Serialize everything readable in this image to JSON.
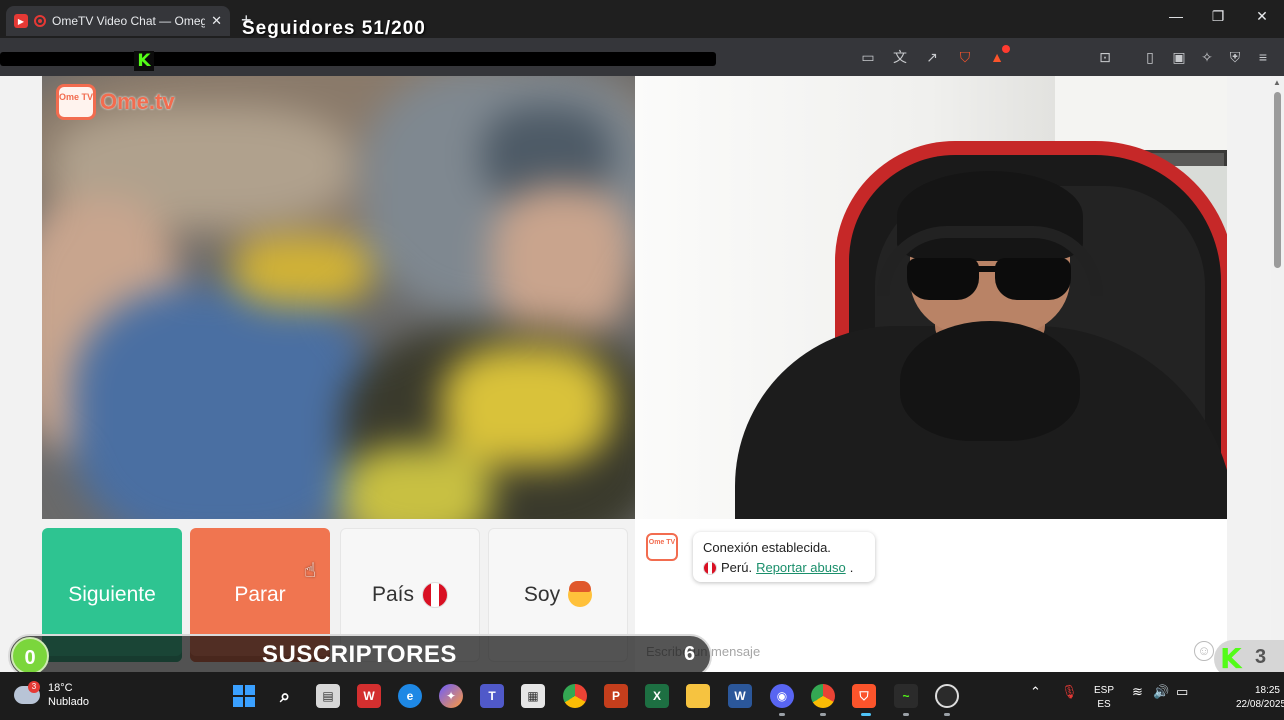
{
  "browser": {
    "tab_title": "OmeTV Video Chat — Omegl",
    "tab_close": "✕",
    "new_tab": "+",
    "window_controls": {
      "minimize": "—",
      "maximize": "❐",
      "close": "✕"
    }
  },
  "stream_overlay": {
    "followers_text": "Seguidores 51/200",
    "subscribers_count": "0",
    "subscribers_label": "SUSCRIPTORES",
    "subscribers_goal": "6",
    "kick_corner_count": "3"
  },
  "ometv": {
    "logo_icon_text": "Ome TV",
    "logo_wordmark": "Ome.tv",
    "buttons": {
      "next": "Siguiente",
      "stop": "Parar",
      "country": "País",
      "gender": "Soy"
    },
    "chat": {
      "icon_text": "Ome TV",
      "status_message": "Conexión establecida.",
      "country_text": "Perú.",
      "report_link": "Reportar abuso",
      "input_placeholder": "Escribe un mensaje"
    }
  },
  "taskbar": {
    "weather_temp": "18°C",
    "weather_desc": "Nublado",
    "weather_badge": "3",
    "lang_line1": "ESP",
    "lang_line2": "ES",
    "time": "18:25",
    "date": "22/08/2025"
  },
  "colors": {
    "next_button": "#2ec491",
    "stop_button": "#f07550",
    "ometv_brand": "#f26c4f",
    "kick_green": "#53fc18",
    "report_link": "#1a8f6b"
  }
}
